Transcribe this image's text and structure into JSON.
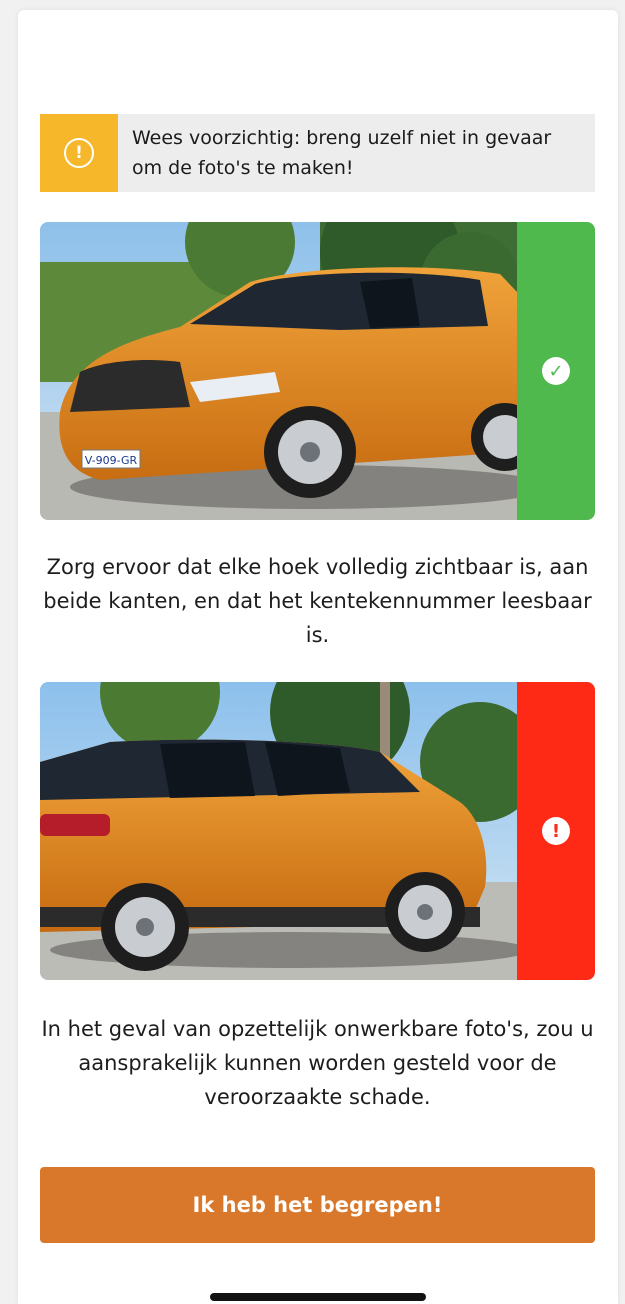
{
  "warning": {
    "icon": "warning-icon",
    "text": "Wees voorzichtig: breng uzelf niet in gevaar om de foto's te maken!",
    "accent": "#f7b72b"
  },
  "good_example": {
    "icon": "checkmark-icon",
    "plate": "V-909-GR",
    "status_color": "#4fb94d",
    "caption": "Zorg ervoor dat elke hoek volledig zichtbaar is, aan beide kanten, en dat het kentekennummer leesbaar is."
  },
  "bad_example": {
    "icon": "exclamation-icon",
    "status_color": "#ff2a16",
    "caption": "In het geval van opzettelijk onwerkbare foto's, zou u aansprakelijk kunnen worden gesteld voor de veroorzaakte schade."
  },
  "cta": {
    "label": "Ik heb het begrepen!",
    "color": "#d9782a"
  }
}
